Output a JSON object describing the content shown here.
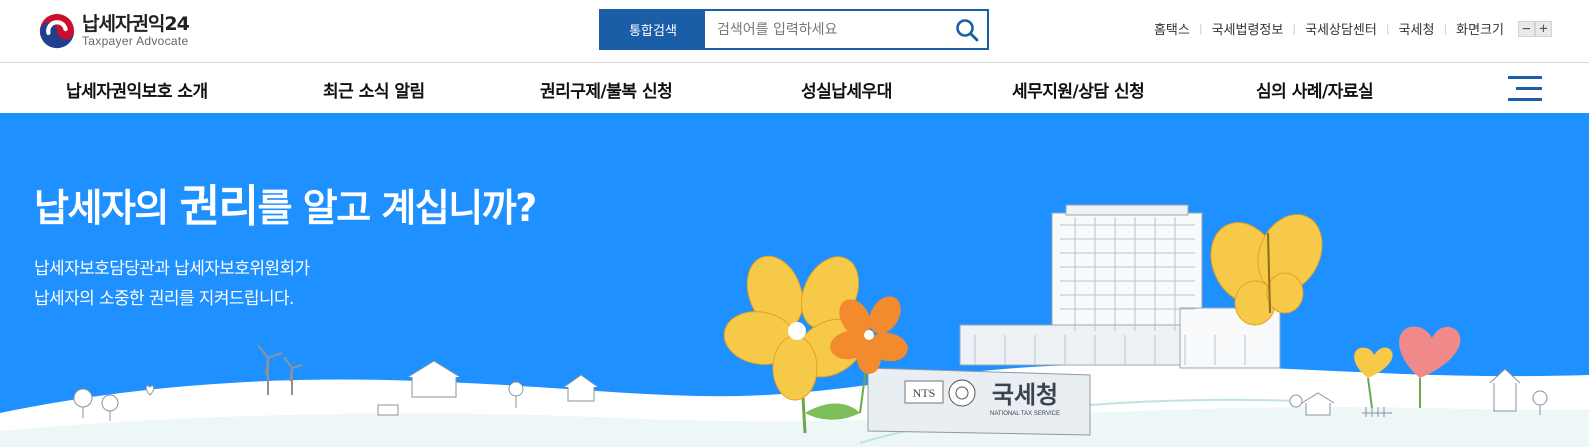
{
  "logo": {
    "title": "납세자권익24",
    "subtitle": "Taxpayer Advocate"
  },
  "search": {
    "button_label": "통합검색",
    "placeholder": "검색어를 입력하세요"
  },
  "utility_links": [
    "홈택스",
    "국세법령정보",
    "국세상담센터",
    "국세청",
    "화면크기"
  ],
  "zoom": {
    "minus": "−",
    "plus": "+"
  },
  "gnb": {
    "items": [
      "납세자권익보호 소개",
      "최근 소식 알림",
      "권리구제/불복 신청",
      "성실납세우대",
      "세무지원/상담 신청",
      "심의 사례/자료실"
    ]
  },
  "hero": {
    "title_before": "납세자의 ",
    "title_emphasis": "권리",
    "title_after": "를 알고 계십니까?",
    "desc_line1": "납세자보호담당관과 납세자보호위원회가",
    "desc_line2": "납세자의 소중한 권리를 지켜드립니다.",
    "sign_nts": "NTS",
    "sign_korean": "국세청",
    "sign_english": "NATIONAL TAX SERVICE"
  },
  "colors": {
    "primary": "#1a5ea8",
    "hero_bg": "#1e90ff",
    "flower_yellow": "#f7c948",
    "flower_orange": "#f28a2e",
    "heart_pink": "#f08a8a"
  }
}
